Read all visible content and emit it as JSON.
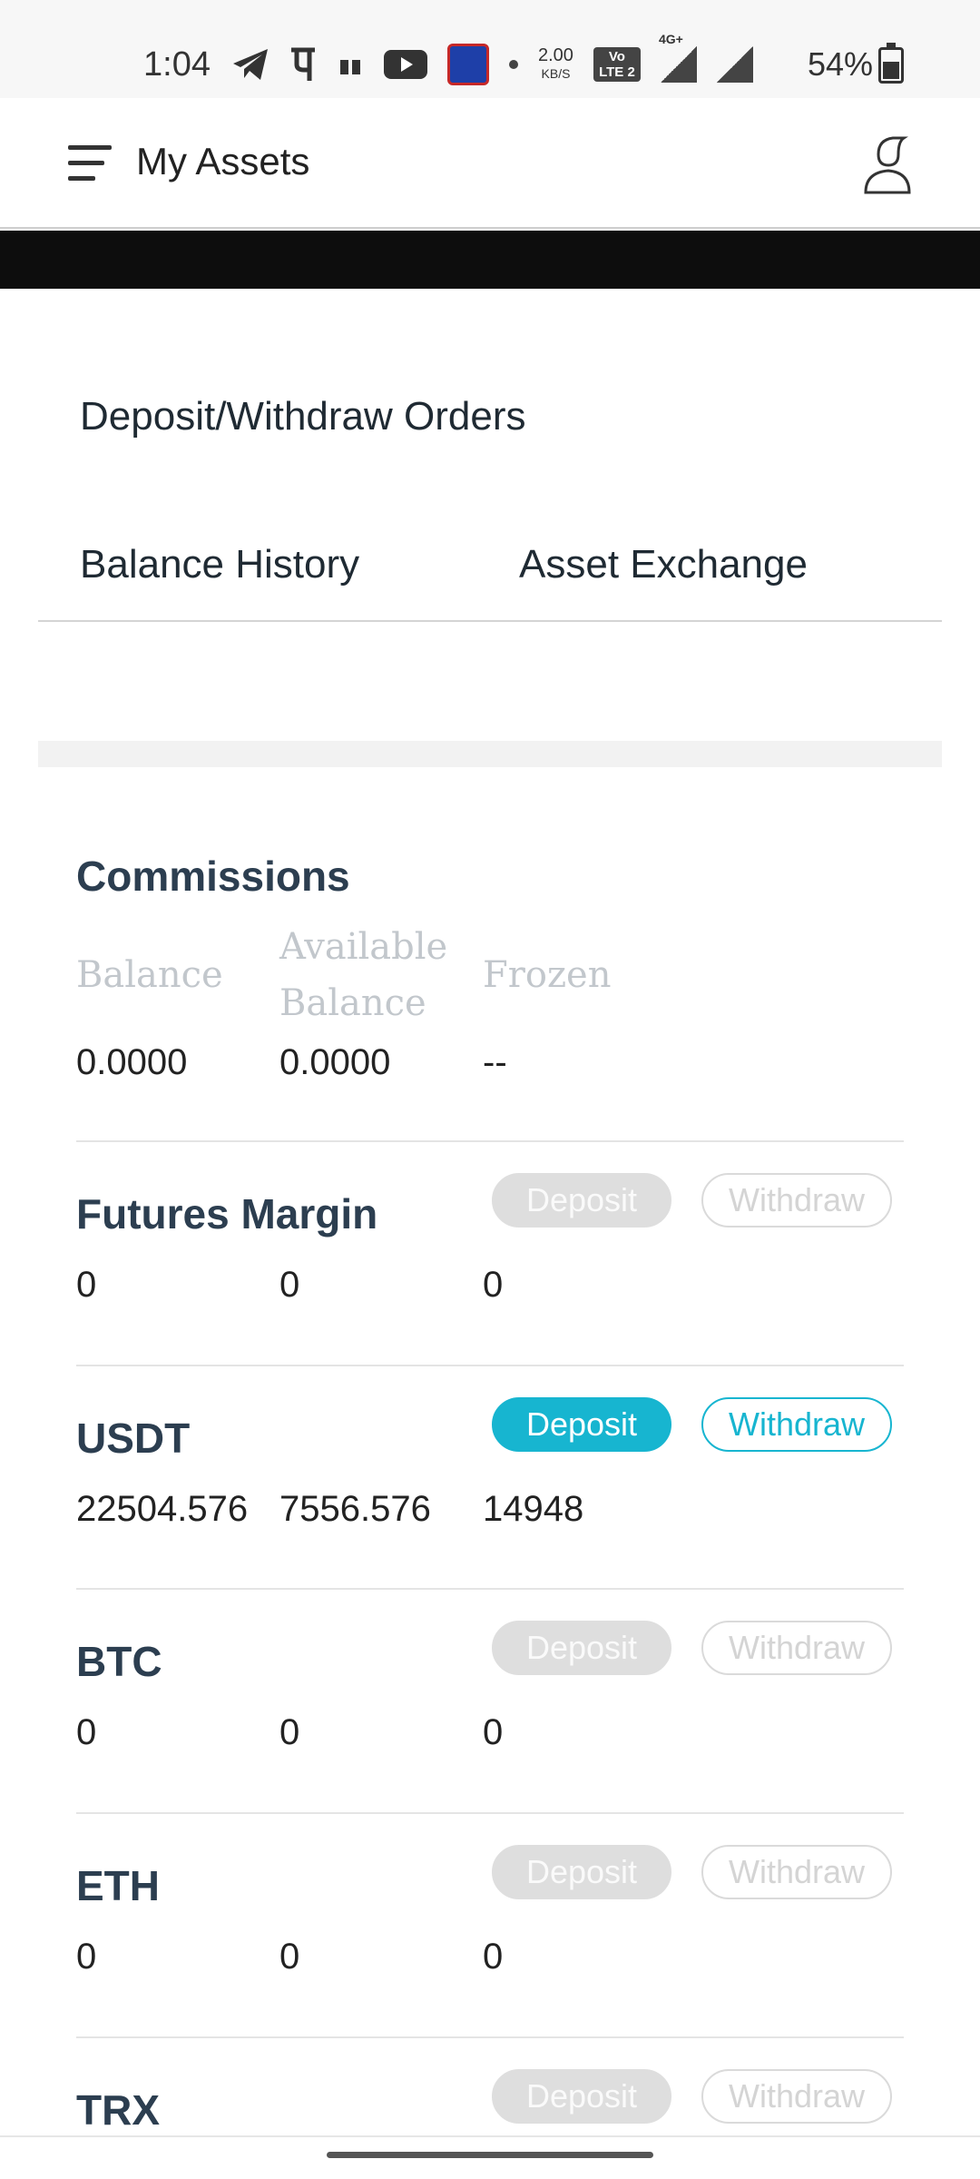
{
  "status_bar": {
    "time": "1:04",
    "net_speed_value": "2.00",
    "net_speed_unit": "KB/S",
    "volte_line1": "Vo",
    "volte_line2": "LTE 2",
    "network": "4G+",
    "battery": "54%"
  },
  "app_bar": {
    "title": "My Assets",
    "menu_icon": "menu-icon",
    "user_icon": "user-icon"
  },
  "links": {
    "deposit_withdraw": "Deposit/Withdraw Orders",
    "balance_history": "Balance History",
    "asset_exchange": "Asset Exchange"
  },
  "commissions": {
    "title": "Commissions",
    "headers": [
      "Balance",
      "Available\nBalance",
      "Frozen"
    ],
    "header_balance": "Balance",
    "header_available_1": "Available",
    "header_available_2": "Balance",
    "header_frozen": "Frozen",
    "balance": "0.0000",
    "available": "0.0000",
    "frozen": "--"
  },
  "assets": [
    {
      "name": "Futures Margin",
      "balance": "0",
      "available": "0",
      "frozen": "0",
      "deposit": "Deposit",
      "withdraw": "Withdraw",
      "enabled": false
    },
    {
      "name": "USDT",
      "balance": "22504.576",
      "available": "7556.576",
      "frozen": "14948",
      "deposit": "Deposit",
      "withdraw": "Withdraw",
      "enabled": true
    },
    {
      "name": "BTC",
      "balance": "0",
      "available": "0",
      "frozen": "0",
      "deposit": "Deposit",
      "withdraw": "Withdraw",
      "enabled": false
    },
    {
      "name": "ETH",
      "balance": "0",
      "available": "0",
      "frozen": "0",
      "deposit": "Deposit",
      "withdraw": "Withdraw",
      "enabled": false
    },
    {
      "name": "TRX",
      "balance": "",
      "available": "",
      "frozen": "",
      "deposit": "Deposit",
      "withdraw": "Withdraw",
      "enabled": false
    }
  ],
  "colors": {
    "accent": "#17b5d0",
    "title": "#2c3e50",
    "disabled": "#dedede"
  }
}
